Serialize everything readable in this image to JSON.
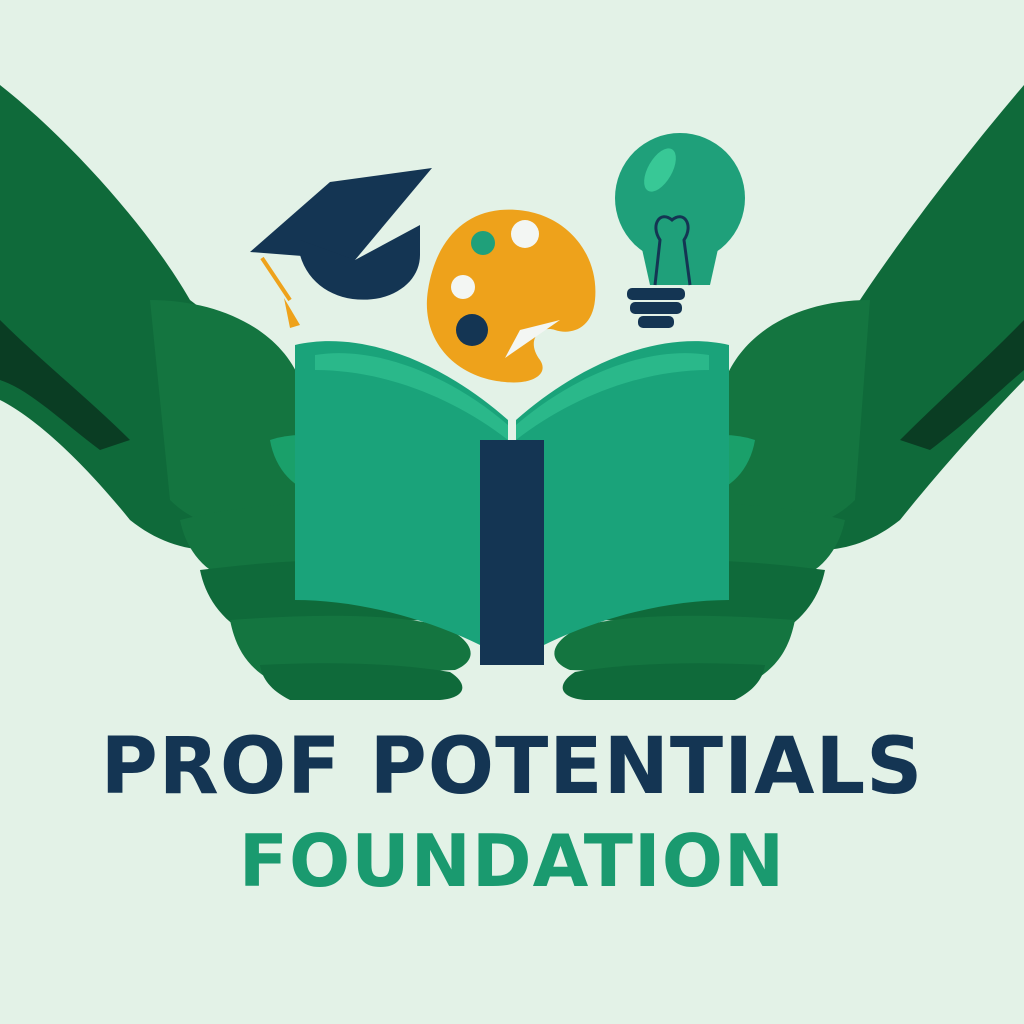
{
  "logo": {
    "title_line1": "PROF POTENTIALS",
    "title_line2": "FOUNDATION",
    "icons": [
      "graduation-cap-icon",
      "paint-palette-icon",
      "light-bulb-icon",
      "open-book-icon",
      "hands-icon"
    ],
    "colors": {
      "background": "#e3f2e7",
      "dark_green": "#0f6a3a",
      "mid_green": "#1a8e56",
      "teal": "#1fa07a",
      "navy": "#143553",
      "orange": "#eea21b"
    }
  }
}
